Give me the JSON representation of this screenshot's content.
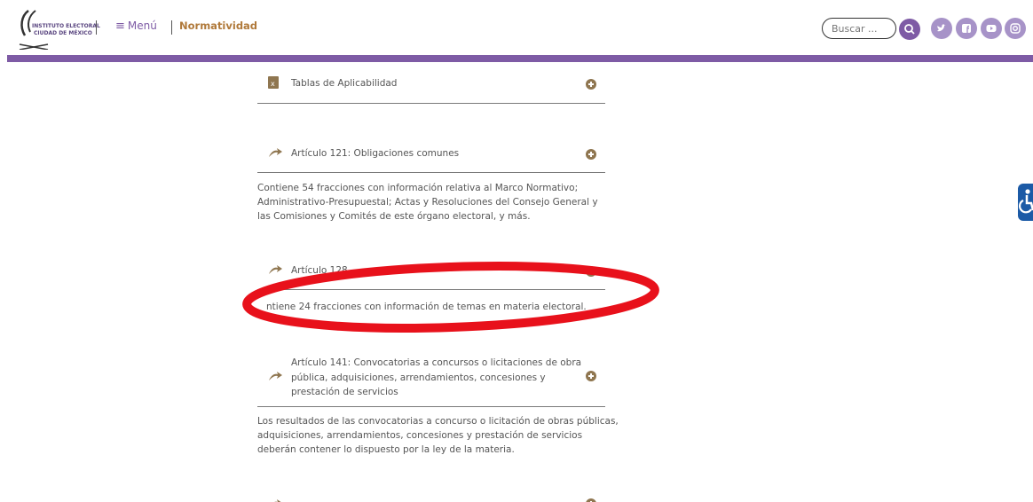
{
  "header": {
    "logo_line1": "INSTITUTO ELECTORAL",
    "logo_line2": "CIUDAD DE MÉXICO",
    "menu_label": "Menú",
    "section_link": "Normatividad",
    "search_placeholder": "Buscar ...",
    "social_icons": [
      "twitter-icon",
      "facebook-icon",
      "youtube-icon",
      "instagram-icon"
    ]
  },
  "sections": [
    {
      "title": "Tablas de Aplicabilidad",
      "icon": "excel-file-icon"
    },
    {
      "title": "Artículo 121: Obligaciones comunes",
      "icon": "arrow-icon",
      "description": "Contiene 54 fracciones con información relativa al Marco Normativo; Administrativo-Presupuestal; Actas y Resoluciones del Consejo General y las Comisiones y Comités de este órgano electoral, y más."
    },
    {
      "title": "Artículo 128",
      "icon": "arrow-icon",
      "description": "ntiene 24 fracciones con información de temas en materia electoral."
    },
    {
      "title": "Artículo 141: Convocatorias a concursos o licitaciones de obra pública, adquisiciones, arrendamientos, concesiones y prestación de servicios",
      "icon": "arrow-icon",
      "description": "Los resultados de las convocatorias a concurso o licitación de obras públicas, adquisiciones, arrendamientos, concesiones y prestación de servicios deberán contener lo dispuesto por la ley de la materia."
    }
  ],
  "colors": {
    "brand_purple": "#7e5ba5",
    "social_purple": "#a793c8",
    "gold_link": "#b0793a",
    "plus_icon": "#8f7650",
    "annotation_red": "#e8111b",
    "accessibility_blue": "#1b5aa6"
  }
}
